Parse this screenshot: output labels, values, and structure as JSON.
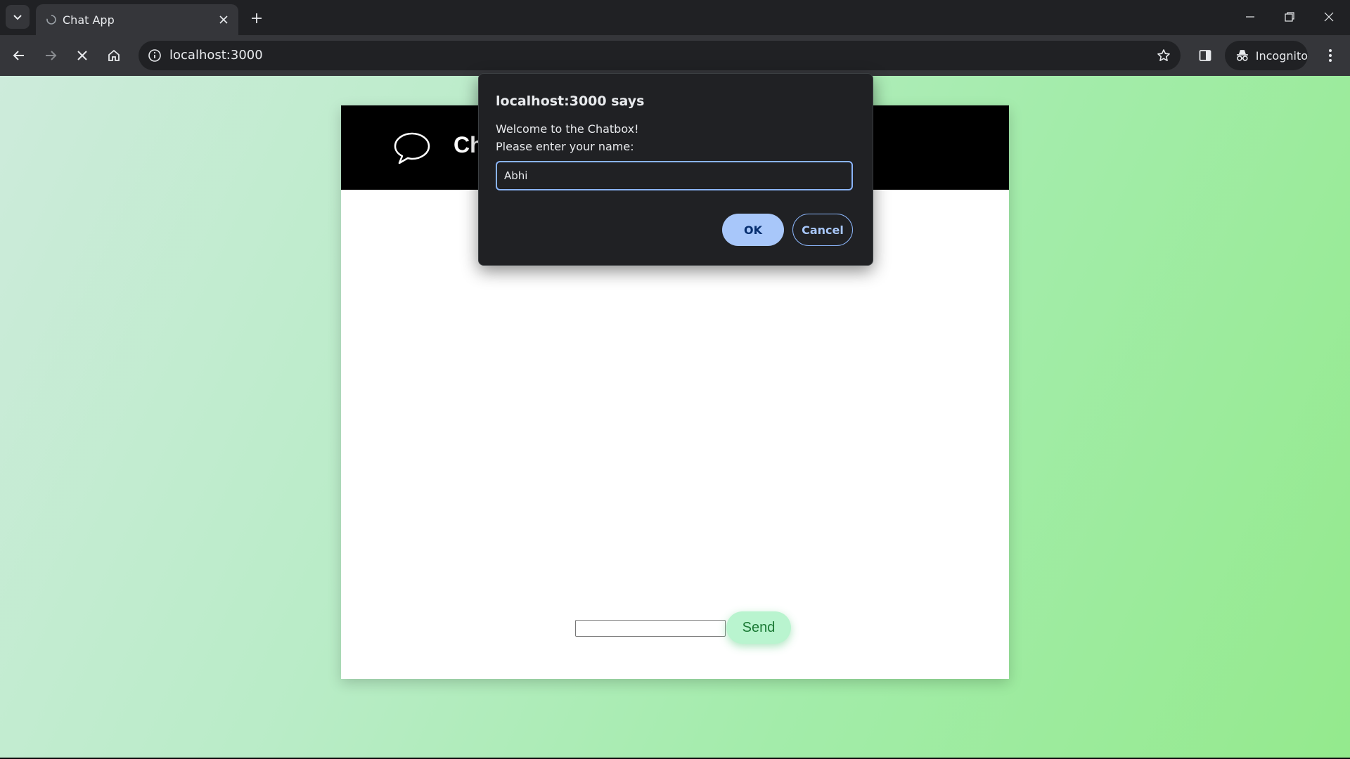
{
  "browser": {
    "tab": {
      "title": "Chat App"
    },
    "address_bar": {
      "url": "localhost:3000"
    },
    "profile_chip": {
      "label": "Incognito"
    },
    "icons": [
      "chevron-down-icon",
      "tab-favicon-icon",
      "close-icon",
      "plus-icon",
      "minimize-icon",
      "restore-icon",
      "window-close-icon",
      "back-icon",
      "forward-icon",
      "stop-icon",
      "home-icon",
      "info-icon",
      "star-icon",
      "side-panel-icon",
      "incognito-icon",
      "more-vert-icon"
    ]
  },
  "page": {
    "header": {
      "title": "Ch"
    },
    "composer": {
      "message_value": "",
      "send_label": "Send"
    }
  },
  "dialog": {
    "title": "localhost:3000 says",
    "message_line1": "Welcome to the Chatbox!",
    "message_line2": "Please enter your name:",
    "input_value": "Abhi",
    "ok_label": "OK",
    "cancel_label": "Cancel"
  },
  "colors": {
    "chrome_dark": "#202124",
    "toolbar": "#35363a",
    "dialog_accent": "#a8c7fa",
    "send_button": "#b9f4cf",
    "header_bg": "#000000"
  }
}
